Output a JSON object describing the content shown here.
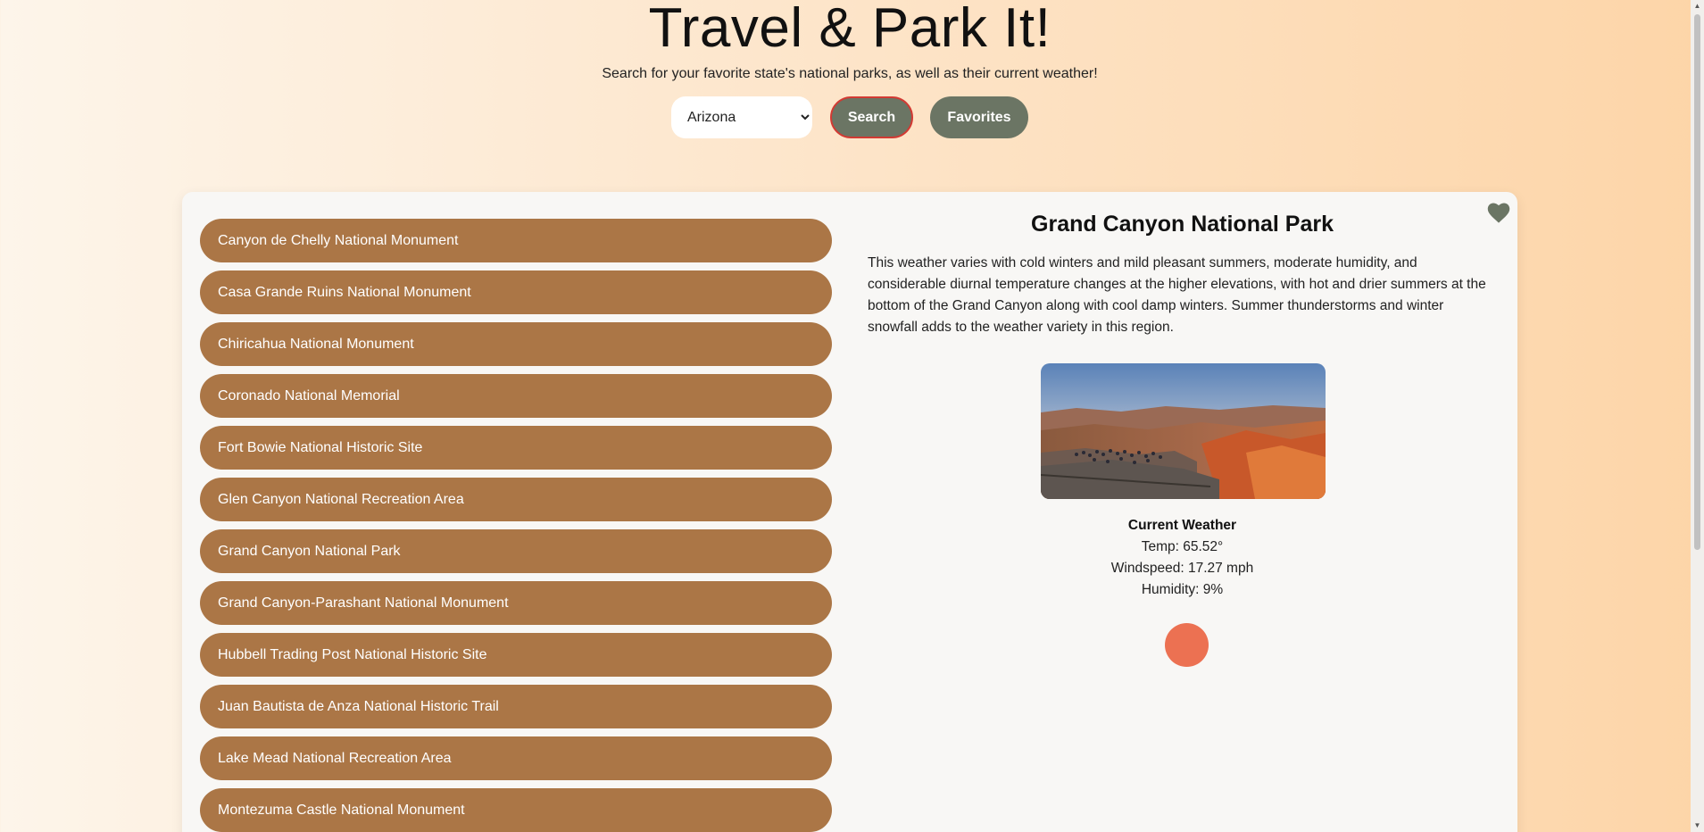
{
  "header": {
    "title": "Travel & Park It!",
    "subtitle": "Search for your favorite state's national parks, as well as their current weather!"
  },
  "search": {
    "selected_state": "Arizona",
    "search_label": "Search",
    "favorites_label": "Favorites"
  },
  "parks": [
    "Canyon de Chelly National Monument",
    "Casa Grande Ruins National Monument",
    "Chiricahua National Monument",
    "Coronado National Memorial",
    "Fort Bowie National Historic Site",
    "Glen Canyon National Recreation Area",
    "Grand Canyon National Park",
    "Grand Canyon-Parashant National Monument",
    "Hubbell Trading Post National Historic Site",
    "Juan Bautista de Anza National Historic Trail",
    "Lake Mead National Recreation Area",
    "Montezuma Castle National Monument"
  ],
  "detail": {
    "name": "Grand Canyon National Park",
    "description": "This weather varies with cold winters and mild pleasant summers, moderate humidity, and considerable diurnal temperature changes at the higher elevations, with hot and drier summers at the bottom of the Grand Canyon along with cool damp winters. Summer thunderstorms and winter snowfall adds to the weather variety in this region.",
    "favorite_icon": "heart-icon",
    "weather": {
      "title": "Current Weather",
      "temp": "Temp: 65.52°",
      "windspeed": "Windspeed: 17.27 mph",
      "humidity": "Humidity: 9%"
    }
  },
  "colors": {
    "park_button": "#ab7646",
    "action_button": "#6b7564",
    "search_border": "#d23a33",
    "weather_indicator": "#ec7152"
  }
}
